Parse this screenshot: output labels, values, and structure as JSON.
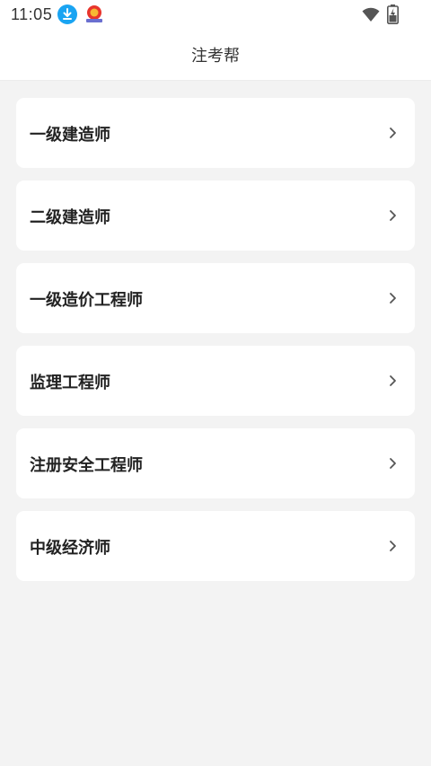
{
  "status_bar": {
    "time": "11:05",
    "icons": [
      "download-icon",
      "app-notification-icon",
      "wifi-icon",
      "battery-icon"
    ]
  },
  "app_bar": {
    "title": "注考帮"
  },
  "exams": [
    {
      "label": "一级建造师"
    },
    {
      "label": "二级建造师"
    },
    {
      "label": "一级造价工程师"
    },
    {
      "label": "监理工程师"
    },
    {
      "label": "注册安全工程师"
    },
    {
      "label": "中级经济师"
    }
  ],
  "colors": {
    "background": "#f3f3f3",
    "card": "#ffffff",
    "text": "#222222",
    "download_badge": "#1aa4f2"
  }
}
